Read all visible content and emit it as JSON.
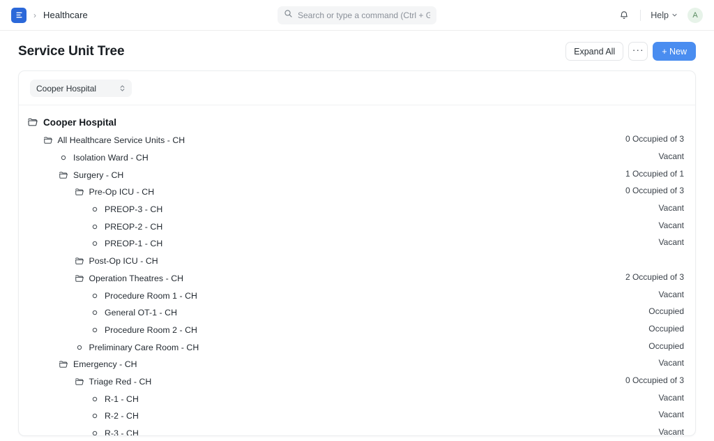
{
  "navbar": {
    "logo_icon": "frappe-logo-icon",
    "breadcrumb_separator": "›",
    "breadcrumb": "Healthcare",
    "search": {
      "icon": "search-icon",
      "placeholder": "Search or type a command (Ctrl + G)",
      "value": ""
    },
    "notifications_icon": "bell-icon",
    "help_label": "Help",
    "help_chevron_icon": "chevron-down-icon",
    "avatar_initial": "A",
    "avatar_color": "#e7f3e9"
  },
  "page": {
    "title": "Service Unit Tree",
    "actions": {
      "expand_all": "Expand All",
      "menu": "···",
      "new": "+ New"
    }
  },
  "toolbar": {
    "company_select": {
      "value": "Cooper Hospital",
      "icon": "select-chevrons-icon"
    }
  },
  "tree": {
    "nodes": [
      {
        "level": 0,
        "icon": "folder-icon",
        "label": "Cooper Hospital",
        "status": ""
      },
      {
        "level": 1,
        "icon": "folder-icon",
        "label": "All Healthcare Service Units - CH",
        "status": "0 Occupied of 3"
      },
      {
        "level": 2,
        "icon": "circle-icon",
        "label": "Isolation Ward - CH",
        "status": "Vacant"
      },
      {
        "level": 2,
        "icon": "folder-icon",
        "label": "Surgery - CH",
        "status": "1 Occupied of 1"
      },
      {
        "level": 3,
        "icon": "folder-icon",
        "label": "Pre-Op ICU - CH",
        "status": "0 Occupied of 3"
      },
      {
        "level": 4,
        "icon": "circle-icon",
        "label": "PREOP-3 - CH",
        "status": "Vacant"
      },
      {
        "level": 4,
        "icon": "circle-icon",
        "label": "PREOP-2 - CH",
        "status": "Vacant"
      },
      {
        "level": 4,
        "icon": "circle-icon",
        "label": "PREOP-1 - CH",
        "status": "Vacant"
      },
      {
        "level": 3,
        "icon": "folder-icon",
        "label": "Post-Op ICU - CH",
        "status": ""
      },
      {
        "level": 3,
        "icon": "folder-icon",
        "label": "Operation Theatres - CH",
        "status": "2 Occupied of 3"
      },
      {
        "level": 4,
        "icon": "circle-icon",
        "label": "Procedure Room 1 - CH",
        "status": "Vacant"
      },
      {
        "level": 4,
        "icon": "circle-icon",
        "label": "General OT-1 - CH",
        "status": "Occupied"
      },
      {
        "level": 4,
        "icon": "circle-icon",
        "label": "Procedure Room 2 - CH",
        "status": "Occupied"
      },
      {
        "level": 3,
        "icon": "circle-icon",
        "label": "Preliminary Care Room - CH",
        "status": "Occupied"
      },
      {
        "level": 2,
        "icon": "folder-icon",
        "label": "Emergency - CH",
        "status": "Vacant"
      },
      {
        "level": 3,
        "icon": "folder-icon",
        "label": "Triage Red - CH",
        "status": "0 Occupied of 3"
      },
      {
        "level": 4,
        "icon": "circle-icon",
        "label": "R-1 - CH",
        "status": "Vacant"
      },
      {
        "level": 4,
        "icon": "circle-icon",
        "label": "R-2 - CH",
        "status": "Vacant"
      },
      {
        "level": 4,
        "icon": "circle-icon",
        "label": "R-3 - CH",
        "status": "Vacant"
      }
    ]
  }
}
